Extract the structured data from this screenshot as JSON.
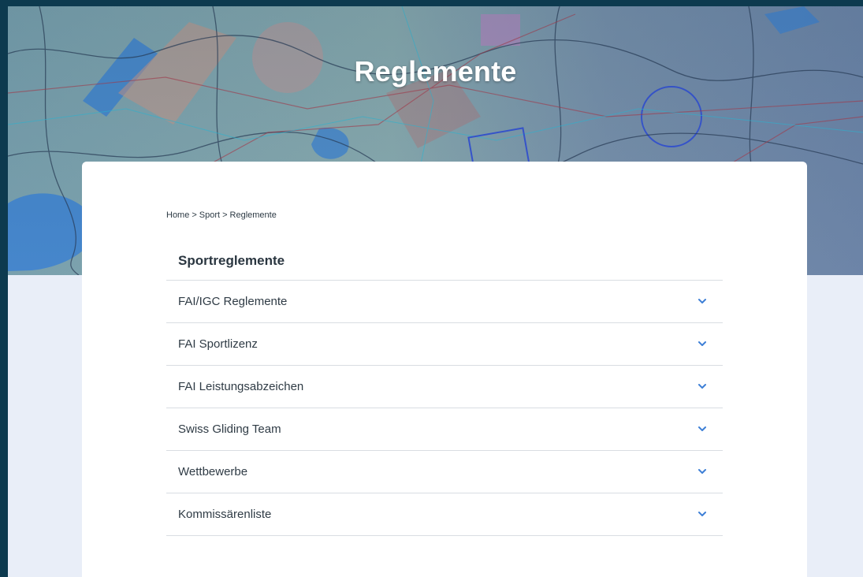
{
  "hero": {
    "title": "Reglemente"
  },
  "breadcrumb": {
    "items": [
      "Home",
      "Sport",
      "Reglemente"
    ],
    "separator": ">"
  },
  "section": {
    "title": "Sportreglemente"
  },
  "accordion": {
    "items": [
      {
        "label": "FAI/IGC Reglemente",
        "icon": "chevron-down-icon"
      },
      {
        "label": "FAI Sportlizenz",
        "icon": "chevron-down-icon"
      },
      {
        "label": "FAI Leistungsabzeichen",
        "icon": "chevron-down-icon"
      },
      {
        "label": "Swiss Gliding Team",
        "icon": "chevron-down-icon"
      },
      {
        "label": "Wettbewerbe",
        "icon": "chevron-down-icon"
      },
      {
        "label": "Kommissärenliste",
        "icon": "chevron-down-icon"
      }
    ]
  },
  "colors": {
    "outer_background": "#0d3a4f",
    "page_background": "#e9eef8",
    "card_background": "#ffffff",
    "accent_chevron": "#3d7fd6",
    "text": "#2f3b45",
    "divider": "#d9dde2"
  }
}
